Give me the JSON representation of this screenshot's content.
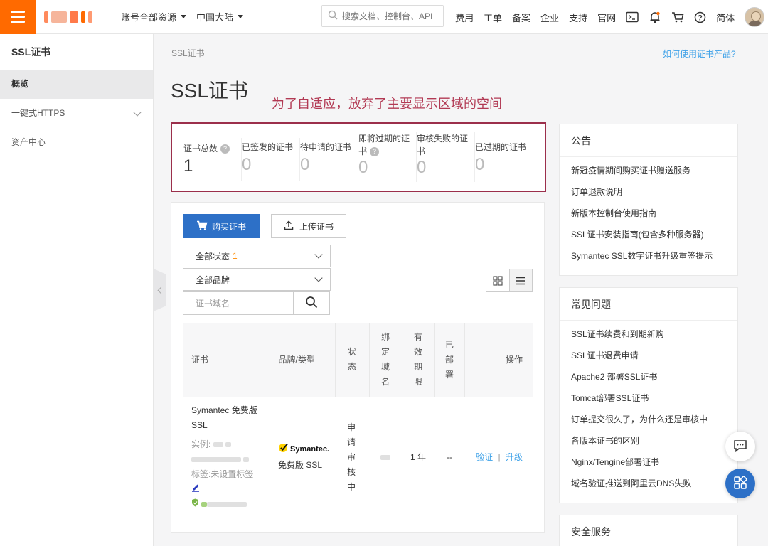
{
  "topbar": {
    "account_dropdown": "账号全部资源",
    "region_dropdown": "中国大陆",
    "search_placeholder": "搜索文档、控制台、API",
    "nav": [
      "费用",
      "工单",
      "备案",
      "企业",
      "支持",
      "官网"
    ],
    "language": "简体",
    "icons": [
      "terminal-icon",
      "bell-icon",
      "cart-icon",
      "help-icon"
    ]
  },
  "sidebar": {
    "title": "SSL证书",
    "items": [
      {
        "label": "概览",
        "active": true
      },
      {
        "label": "一键式HTTPS",
        "expandable": true
      },
      {
        "label": "资产中心"
      }
    ]
  },
  "main": {
    "breadcrumb": "SSL证书",
    "help_link": "如何使用证书产品?",
    "title": "SSL证书",
    "annotation": "为了自适应，放弃了主要显示区域的空间",
    "stats": [
      {
        "label": "证书总数",
        "value": "1",
        "has_help": true
      },
      {
        "label": "已签发的证书",
        "value": "0"
      },
      {
        "label": "待申请的证书",
        "value": "0"
      },
      {
        "label_line1": "即将过期的证",
        "label_line2": "书",
        "value": "0",
        "has_help": true
      },
      {
        "label_line1": "审核失败的证",
        "label_line2": "书",
        "value": "0"
      },
      {
        "label": "已过期的证书",
        "value": "0"
      }
    ],
    "buttons": {
      "buy": "购买证书",
      "upload": "上传证书"
    },
    "filters": {
      "status_label": "全部状态",
      "status_count": "1",
      "brand_label": "全部品牌",
      "domain_placeholder": "证书域名"
    },
    "table": {
      "headers": [
        "证书",
        "品牌/类型",
        "状态",
        "绑定域名",
        "有效期限",
        "已部署",
        "操作"
      ],
      "row": {
        "cert_name_line1": "Symantec 免费版",
        "cert_name_line2": "SSL",
        "instance_label": "实例:",
        "tag_label": "标签:未设置标签",
        "brand_logo": "Symantec.",
        "brand_type": "免费版 SSL",
        "status": "申请审核中",
        "validity": "1 年",
        "deployed": "--",
        "action_verify": "验证",
        "action_upgrade": "升级"
      }
    }
  },
  "right": {
    "announcements": {
      "title": "公告",
      "items": [
        "新冠疫情期间购买证书赠送服务",
        "订单退款说明",
        "新版本控制台使用指南",
        "SSL证书安装指南(包含多种服务器)",
        "Symantec SSL数字证书升级重签提示"
      ]
    },
    "faq": {
      "title": "常见问题",
      "items": [
        "SSL证书续费和到期新购",
        "SSL证书退费申请",
        "Apache2 部署SSL证书",
        "Tomcat部署SSL证书",
        "订单提交很久了，为什么还是审核中",
        "各版本证书的区别",
        "Nginx/Tengine部署证书",
        "域名验证推送到阿里云DNS失败"
      ]
    },
    "security": {
      "title": "安全服务"
    }
  },
  "colors": {
    "brand_orange": "#ff6a00",
    "primary_blue": "#2d70c7",
    "link_blue": "#3da1e8",
    "annotation_red": "#b23a54",
    "highlight_border": "#9b2f4b"
  }
}
